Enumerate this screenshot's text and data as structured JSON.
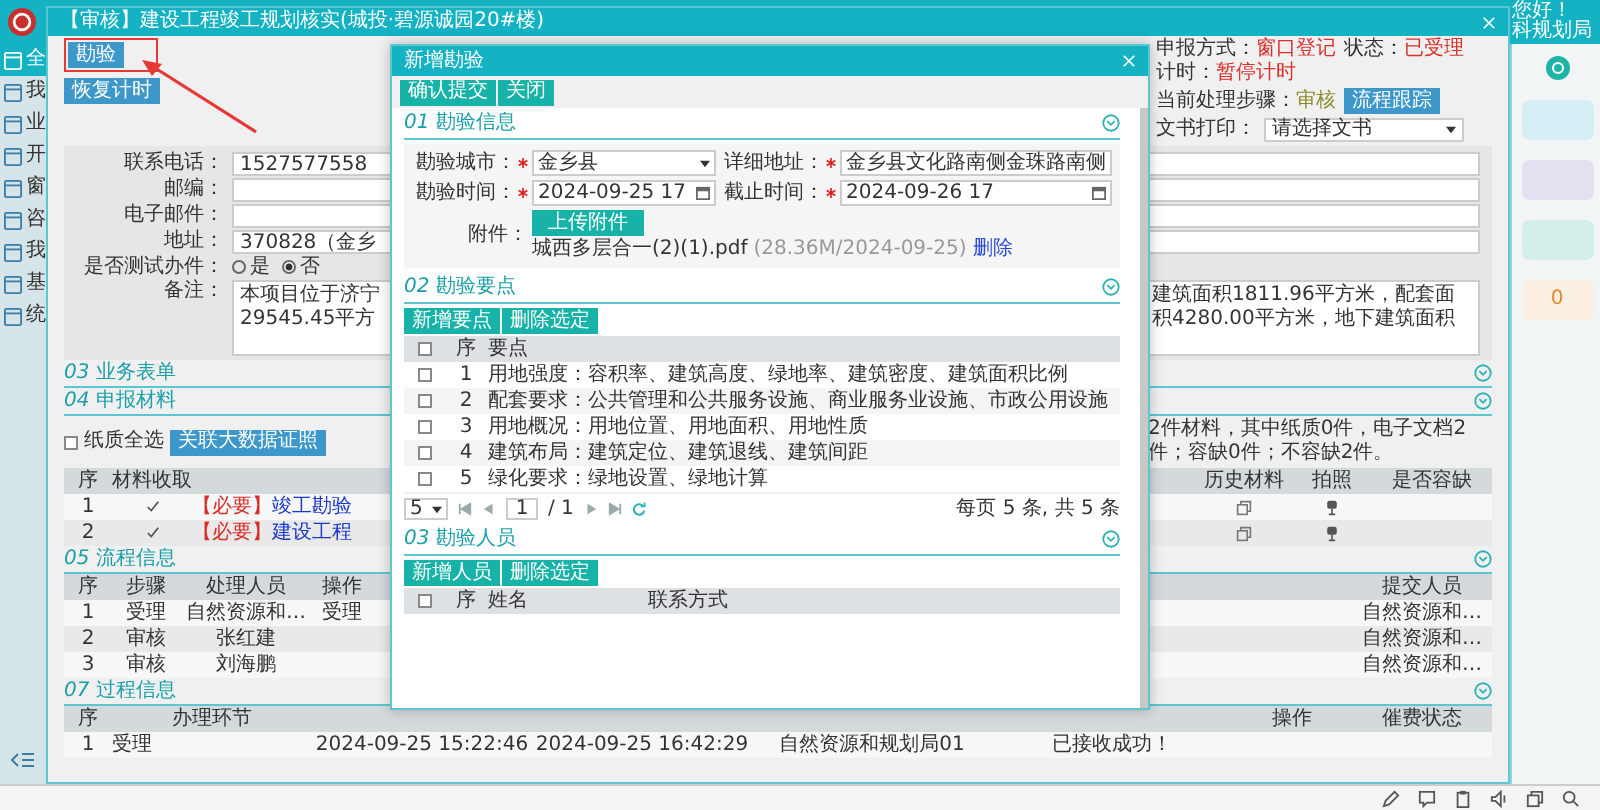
{
  "app": {
    "greeting": "您好！",
    "user": "科规划局",
    "sidebar": [
      {
        "label": "全",
        "selected": true
      },
      {
        "label": "我",
        "selected": false
      },
      {
        "label": "业",
        "selected": false
      },
      {
        "label": "开",
        "selected": false
      },
      {
        "label": "窗",
        "selected": false
      },
      {
        "label": "咨",
        "selected": false
      },
      {
        "label": "我",
        "selected": false
      },
      {
        "label": "基",
        "selected": false
      },
      {
        "label": "统",
        "selected": false
      }
    ],
    "right_cards": [
      {
        "color": "#d6eef5"
      },
      {
        "color": "#e3e0f0"
      },
      {
        "color": "#d4efe9"
      },
      {
        "color": "#fbeee2",
        "count": "0"
      }
    ]
  },
  "case_window": {
    "title": "【审核】建设工程竣工规划核实(城投·碧源诚园20#楼)",
    "buttons": [
      {
        "label": "勘验",
        "highlighted": true
      },
      {
        "label": "恢复计时",
        "highlighted": false
      }
    ],
    "status": [
      {
        "label": "申报方式：",
        "value": "窗口登记"
      },
      {
        "label": "状态：",
        "value": "已受理"
      },
      {
        "label": "计时：",
        "value": "暂停计时"
      }
    ],
    "current_step": {
      "label": "当前处理步骤：",
      "value": "审核"
    },
    "track_button": "流程跟踪",
    "print": {
      "label": "文书打印：",
      "placeholder": "请选择文书"
    },
    "form": [
      {
        "kind": "text",
        "label": "联系电话：",
        "value": "1527577558"
      },
      {
        "kind": "text",
        "label": "邮编："
      },
      {
        "kind": "text",
        "label": "电子邮件："
      },
      {
        "kind": "text",
        "label": "地址：",
        "value": "370828（金乡"
      },
      {
        "kind": "radio",
        "label": "是否测试办件：",
        "options": [
          {
            "label": "是",
            "selected": false
          },
          {
            "label": "否",
            "selected": true
          }
        ]
      },
      {
        "kind": "textarea",
        "label": "备注：",
        "visible_start": [
          "本项目位于济宁",
          "29545.45平方"
        ],
        "visible_end": "建筑面积1811.96平方米，配套面积4280.00平方米，地下建筑面积"
      }
    ],
    "business_form": {
      "number": "03",
      "title": "业务表单"
    },
    "materials": {
      "number": "04",
      "title": "申报材料",
      "select_all": {
        "label": "纸质全选",
        "checked": false
      },
      "link_button": "关联大数据证照",
      "summary": "2件材料，其中纸质0件，电子文档2件；容缺0件；不容缺2件。",
      "columns": [
        "序",
        "材料收取",
        "历史材料",
        "拍照",
        "是否容缺"
      ],
      "rows": [
        {
          "no": "1",
          "received": true,
          "tag": "【必要】",
          "name": "竣工勘验"
        },
        {
          "no": "2",
          "received": true,
          "tag": "【必要】",
          "name": "建设工程"
        }
      ]
    },
    "flow": {
      "number": "05",
      "title": "流程信息",
      "columns": [
        "序",
        "步骤",
        "处理人员",
        "操作",
        "提交人员"
      ],
      "rows": [
        {
          "no": "1",
          "step": "受理",
          "handler": "自然资源和…",
          "action": "受理",
          "submitter": "自然资源和…"
        },
        {
          "no": "2",
          "step": "审核",
          "handler": "张红建",
          "submitter": "自然资源和…"
        },
        {
          "no": "3",
          "step": "审核",
          "handler": "刘海鹏",
          "submitter": "自然资源和…"
        }
      ]
    },
    "process": {
      "number": "07",
      "title": "过程信息",
      "columns": [
        "序",
        "办理环节",
        "操作",
        "催费状态"
      ],
      "rows": [
        {
          "no": "1",
          "stage": "受理",
          "start": "2024-09-25 15:22:46",
          "end": "2024-09-25 16:42:29",
          "handler": "自然资源和规划局01",
          "opinion": "已接收成功！"
        }
      ]
    }
  },
  "dialog": {
    "title": "新增勘验",
    "toolbar": [
      "确认提交",
      "关闭"
    ],
    "info": {
      "number": "01",
      "title": "勘验信息",
      "fields": [
        {
          "kind": "select",
          "label": "勘验城市：",
          "required": true,
          "value": "金乡县"
        },
        {
          "kind": "text",
          "label": "详细地址：",
          "required": true,
          "value": "金乡县文化路南侧金珠路南侧"
        },
        {
          "kind": "date",
          "label": "勘验时间：",
          "required": true,
          "value": "2024-09-25 17"
        },
        {
          "kind": "date",
          "label": "截止时间：",
          "required": true,
          "value": "2024-09-26 17"
        }
      ],
      "attachment": {
        "label": "附件：",
        "button": "上传附件",
        "file": "城西多层合一(2)(1).pdf",
        "meta": "(28.36M/2024-09-25)",
        "delete": "删除"
      }
    },
    "points": {
      "number": "02",
      "title": "勘验要点",
      "buttons": [
        "新增要点",
        "删除选定"
      ],
      "all_checked": false,
      "columns": [
        "序",
        "要点"
      ],
      "rows": [
        {
          "no": "1",
          "text": "用地强度：容积率、建筑高度、绿地率、建筑密度、建筑面积比例",
          "checked": false
        },
        {
          "no": "2",
          "text": "配套要求：公共管理和公共服务设施、商业服务业设施、市政公用设施",
          "checked": false
        },
        {
          "no": "3",
          "text": "用地概况：用地位置、用地面积、用地性质",
          "checked": false
        },
        {
          "no": "4",
          "text": "建筑布局：建筑定位、建筑退线、建筑间距",
          "checked": false
        },
        {
          "no": "5",
          "text": "绿化要求：绿地设置、绿地计算",
          "checked": false
        }
      ],
      "pager": {
        "page_size": "5",
        "page": "1",
        "total_pages": "/ 1",
        "summary": "每页 5 条, 共 5 条"
      }
    },
    "staff": {
      "number": "03",
      "title": "勘验人员",
      "buttons": [
        "新增人员",
        "删除选定"
      ],
      "all_checked": false,
      "columns": [
        "序",
        "姓名",
        "联系方式"
      ]
    }
  }
}
